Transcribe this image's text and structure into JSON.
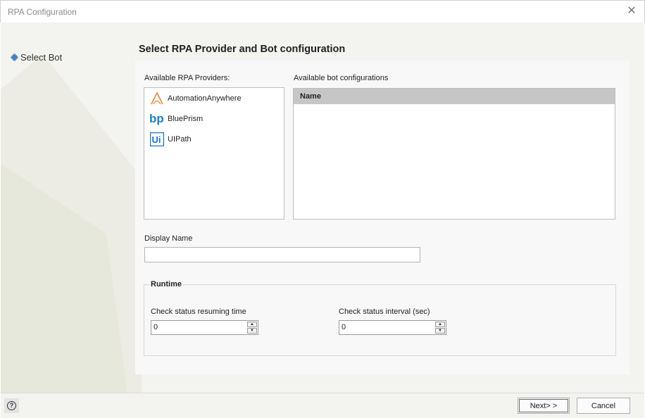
{
  "window": {
    "title": "RPA Configuration"
  },
  "sidebar": {
    "items": [
      {
        "label": "Select Bot"
      }
    ]
  },
  "page": {
    "title": "Select RPA Provider and Bot configuration"
  },
  "providers": {
    "label": "Available RPA Providers:",
    "items": [
      {
        "name": "AutomationAnywhere",
        "icon": "automation-anywhere-logo",
        "color": "#e8833a"
      },
      {
        "name": "BluePrism",
        "icon": "blueprism-logo",
        "color": "#1f7fc4"
      },
      {
        "name": "UIPath",
        "icon": "uipath-logo",
        "color": "#1f73c0"
      }
    ]
  },
  "bots": {
    "label": "Available bot configurations",
    "columns": [
      "Name"
    ],
    "rows": []
  },
  "display_name": {
    "label": "Display Name",
    "value": ""
  },
  "runtime": {
    "title": "Runtime",
    "resuming": {
      "label": "Check status resuming time",
      "value": "0"
    },
    "interval": {
      "label": "Check status interval (sec)",
      "value": "0"
    }
  },
  "footer": {
    "next_label": "Next> >",
    "cancel_label": "Cancel"
  }
}
